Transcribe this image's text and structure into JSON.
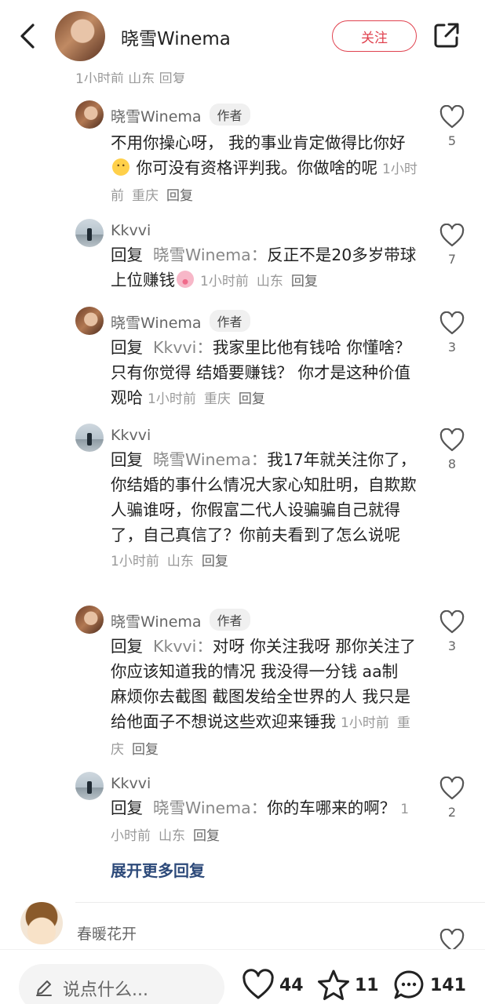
{
  "header": {
    "name": "晓雪Winema",
    "follow_label": "关注"
  },
  "cut_meta": "1小时前  山东  回复",
  "comments": [
    {
      "name": "晓雪Winema",
      "badge": "作者",
      "text_a": "不用你操心呀， 我的事业肯定做得比你好",
      "text_b": " 你可没有资格评判我。你做啥的呢",
      "emoji": "thinking-face-emoji",
      "time": "1小时前",
      "location": "重庆",
      "reply_label": "回复",
      "likes": "5"
    },
    {
      "name": "Kkvvi",
      "reply_prefix": "回复",
      "reply_target": "晓雪Winema：",
      "text_a": "反正不是20多岁带球上位赚钱",
      "emoji": "pig-face-emoji",
      "time": "1小时前",
      "location": "山东",
      "reply_label": "回复",
      "likes": "7"
    },
    {
      "name": "晓雪Winema",
      "badge": "作者",
      "reply_prefix": "回复",
      "reply_target": "Kkvvi：",
      "text_a": "我家里比他有钱哈 你懂啥？ 只有你觉得 结婚要赚钱？ 你才是这种价值观哈",
      "time": "1小时前",
      "location": "重庆",
      "reply_label": "回复",
      "likes": "3"
    },
    {
      "name": "Kkvvi",
      "reply_prefix": "回复",
      "reply_target": "晓雪Winema：",
      "text_a": "我17年就关注你了，你结婚的事什么情况大家心知肚明，自欺欺人骗谁呀，你假富二代人设骗骗自己就得了，自己真信了？你前夫看到了怎么说呢",
      "time": "1小时前",
      "location": "山东",
      "reply_label": "回复",
      "likes": "8"
    },
    {
      "name": "晓雪Winema",
      "badge": "作者",
      "reply_prefix": "回复",
      "reply_target": "Kkvvi：",
      "text_a": "对呀 你关注我呀 那你关注了你应该知道我的情况 我没得一分钱 aa制 麻烦你去截图 截图发给全世界的人 我只是给他面子不想说这些欢迎来锤我",
      "time": "1小时前",
      "location": "重庆",
      "reply_label": "回复",
      "likes": "3"
    },
    {
      "name": "Kkvvi",
      "reply_prefix": "回复",
      "reply_target": "晓雪Winema：",
      "text_a": "你的车哪来的啊？",
      "time": "1小时前",
      "location": "山东",
      "reply_label": "回复",
      "likes": "2"
    }
  ],
  "more_replies": "展开更多回复",
  "next_comment": {
    "name": "春暖花开"
  },
  "bottom": {
    "input_placeholder": "说点什么...",
    "likes": "44",
    "favorites": "11",
    "comments": "141"
  },
  "colors": {
    "accent": "#e0424f",
    "link": "#2d4a7a"
  }
}
